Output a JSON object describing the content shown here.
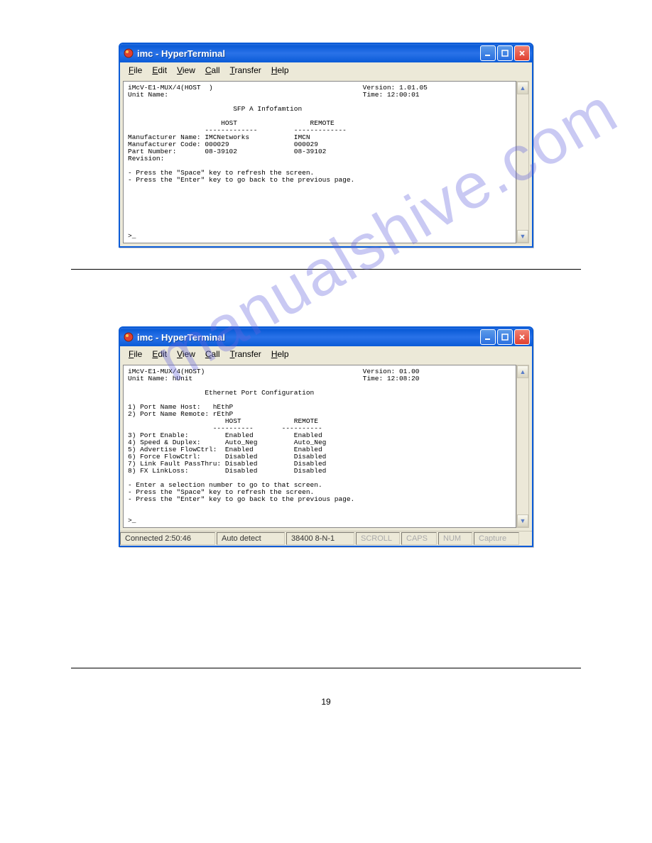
{
  "watermark": "manualshive.com",
  "win1": {
    "title": "imc - HyperTerminal",
    "menu": [
      "File",
      "Edit",
      "View",
      "Call",
      "Transfer",
      "Help"
    ],
    "terminal": "iMcV-E1-MUX/4(HOST  )                                     Version: 1.01.05\nUnit Name:                                                Time: 12:00:01\n\n                          SFP A Infofamtion\n\n                       HOST                  REMOTE\n                   -------------         -------------\nManufacturer Name: IMCNetworks           IMCN\nManufacturer Code: 000029                000029\nPart Number:       08-39102              08-39102\nRevision:\n\n- Press the \"Space\" key to refresh the screen.\n- Press the \"Enter\" key to go back to the previous page.\n\n\n\n\n\n\n\n>_"
  },
  "win2": {
    "title": "imc - HyperTerminal",
    "menu": [
      "File",
      "Edit",
      "View",
      "Call",
      "Transfer",
      "Help"
    ],
    "terminal": "iMcV-E1-MUX/4(HOST)                                       Version: 01.00\nUnit Name: hUnit                                          Time: 12:08:20\n\n                   Ethernet Port Configuration\n\n1) Port Name Host:   hEthP\n2) Port Name Remote: rEthP\n                        HOST             REMOTE\n                     ----------       ----------\n3) Port Enable:         Enabled          Enabled\n4) Speed & Duplex:      Auto_Neg         Auto_Neg\n5) Advertise FlowCtrl:  Enabled          Enabled\n6) Force FlowCtrl:      Disabled         Disabled\n7) Link Fault PassThru: Disabled         Disabled\n8) FX LinkLoss:         Disabled         Disabled\n\n- Enter a selection number to go to that screen.\n- Press the \"Space\" key to refresh the screen.\n- Press the \"Enter\" key to go back to the previous page.\n\n\n>_",
    "status": {
      "connected": "Connected 2:50:46",
      "detect": "Auto detect",
      "conn": "38400 8-N-1",
      "scroll": "SCROLL",
      "caps": "CAPS",
      "num": "NUM",
      "capture": "Capture"
    }
  },
  "page_number": "19"
}
